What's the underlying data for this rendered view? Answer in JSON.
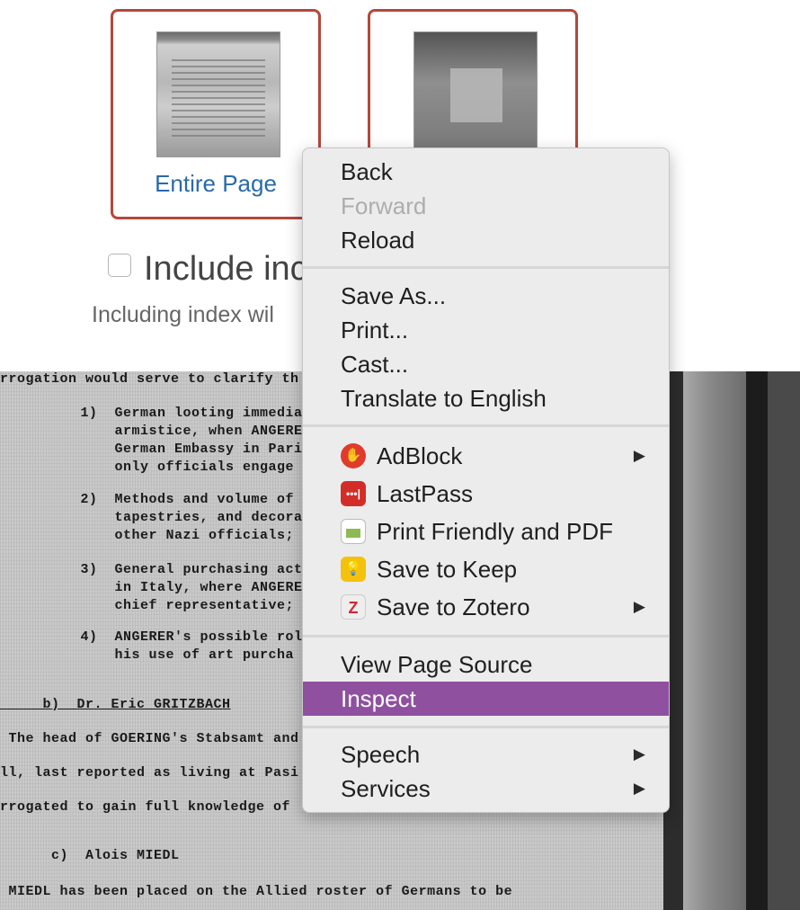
{
  "cards": {
    "entire_page_label": "Entire Page",
    "second_label": ""
  },
  "include_index": {
    "label": "Include inc",
    "help": "Including index wil"
  },
  "document_lines": [
    "rrogation would serve to clarify th",
    "     1)  German looting immediat",
    "         armistice, when ANGERE",
    "         German Embassy in Pari",
    "         only officials engage",
    "     2)  Methods and volume of s",
    "         tapestries, and decora",
    "         other Nazi officials;",
    "     3)  General purchasing act",
    "         in Italy, where ANGERE",
    "         chief representative;",
    "     4)  ANGERER's possible rol",
    "         his use of art purcha",
    "     b)  Dr. Eric GRITZBACH",
    " The head of GOERING's Stabsamt and",
    "ll, last reported as living at Pasi",
    "rrogated to gain full knowledge of",
    "      c)  Alois MIEDL",
    " MIEDL has been placed on the Allied roster of Germans to be"
  ],
  "context_menu": {
    "back": "Back",
    "forward": "Forward",
    "reload": "Reload",
    "save_as": "Save As...",
    "print": "Print...",
    "cast": "Cast...",
    "translate": "Translate to English",
    "adblock": "AdBlock",
    "lastpass": "LastPass",
    "print_friendly": "Print Friendly and PDF",
    "save_to_keep": "Save to Keep",
    "save_to_zotero": "Save to Zotero",
    "view_source": "View Page Source",
    "inspect": "Inspect",
    "speech": "Speech",
    "services": "Services",
    "submenu_arrow": "▶"
  },
  "icons": {
    "adblock": "adblock-icon",
    "lastpass": "lastpass-icon",
    "print_friendly": "print-friendly-icon",
    "keep": "keep-icon",
    "zotero": "zotero-icon"
  },
  "colors": {
    "card_border": "#b5473c",
    "link_blue": "#2a6aab",
    "menu_highlight": "#8f50a0"
  }
}
